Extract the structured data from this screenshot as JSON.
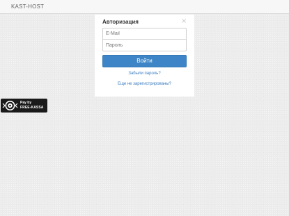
{
  "header": {
    "brand": "KAST-HOST"
  },
  "login": {
    "title": "Авторизация",
    "close_icon": "close-icon",
    "email_placeholder": "E-Mail",
    "password_placeholder": "Пароль",
    "submit_label": "Войти",
    "forgot_link": "Забыли пароль?",
    "register_link": "Еще не зарегистрированы?",
    "accent_color": "#3d85c6"
  },
  "payment_badge": {
    "line1": "Pay by",
    "line2": "FREE-KASSA",
    "icon": "free-kassa-logo-icon"
  }
}
